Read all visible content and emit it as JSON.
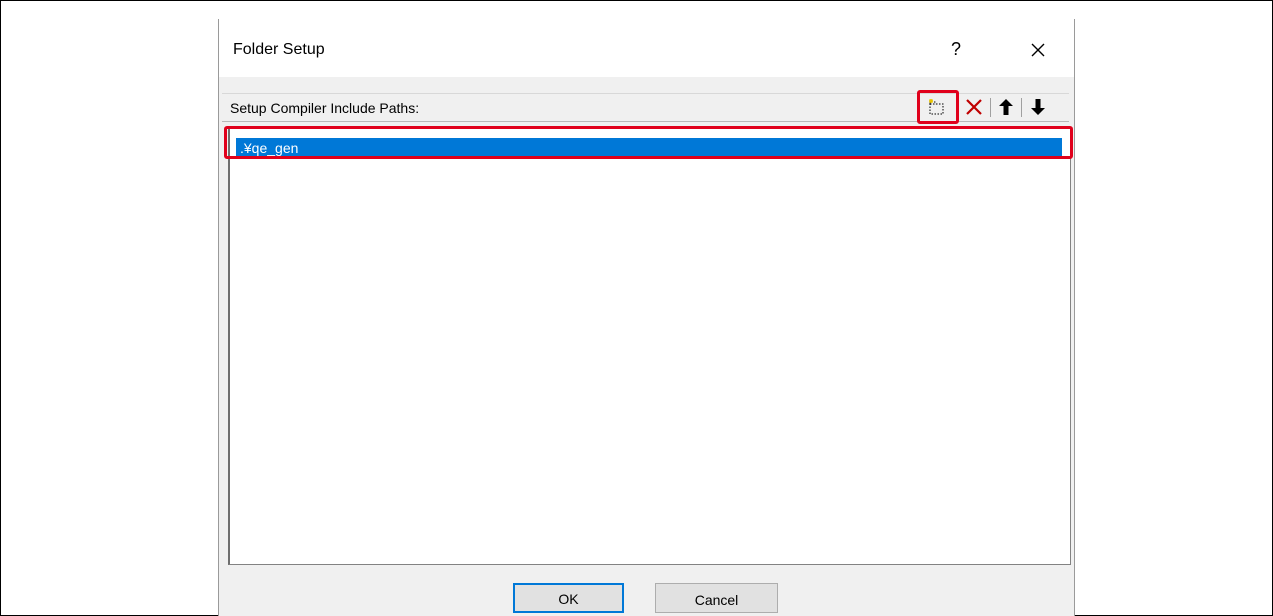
{
  "dialog": {
    "title": "Folder Setup",
    "help_label": "?",
    "close_icon": "close-icon"
  },
  "toolbar": {
    "label": "Setup Compiler Include Paths:",
    "buttons": [
      {
        "name": "new-folder-icon"
      },
      {
        "name": "delete-icon"
      },
      {
        "name": "arrow-up-icon"
      },
      {
        "name": "arrow-down-icon"
      }
    ]
  },
  "list": {
    "items": [
      ".¥qe_gen"
    ]
  },
  "footer": {
    "ok_label": "OK",
    "cancel_label": "Cancel"
  },
  "colors": {
    "selection": "#0078d7",
    "highlight_annotation": "#e0001b",
    "delete_icon": "#c00000"
  }
}
